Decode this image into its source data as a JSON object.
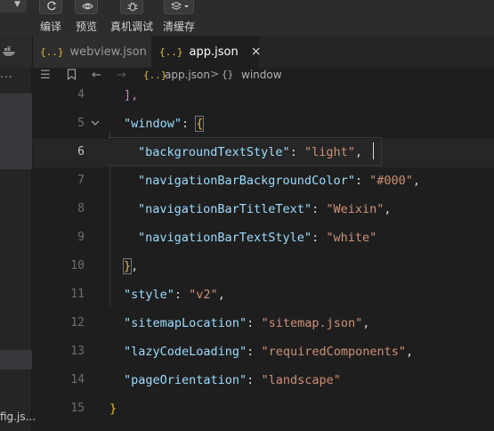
{
  "toolbar": {
    "buttons": [
      {
        "label": "编译",
        "icon": "refresh-icon"
      },
      {
        "label": "预览",
        "icon": "eye-icon"
      },
      {
        "label": "真机调试",
        "icon": "bug-icon"
      },
      {
        "label": "清缓存",
        "icon": "layers-icon"
      }
    ]
  },
  "sidebar": {
    "more": "...",
    "file_fragment": "fig.js..."
  },
  "tabs": [
    {
      "label": "webview.json",
      "active": false
    },
    {
      "label": "app.json",
      "active": true,
      "close": "×"
    }
  ],
  "breadcrumb": {
    "file": "app.json",
    "separator": ">",
    "object_icon": "{}",
    "section": "window"
  },
  "editor": {
    "active_line": 6,
    "lines": [
      {
        "n": "4",
        "parts": [
          "],"
        ]
      },
      {
        "n": "5",
        "parts": [
          "\"window\"",
          ": ",
          "{"
        ]
      },
      {
        "n": "6",
        "parts": [
          "\"backgroundTextStyle\"",
          ": ",
          "\"light\"",
          ","
        ]
      },
      {
        "n": "7",
        "parts": [
          "\"navigationBarBackgroundColor\"",
          ": ",
          "\"#000\"",
          ","
        ]
      },
      {
        "n": "8",
        "parts": [
          "\"navigationBarTitleText\"",
          ": ",
          "\"Weixin\"",
          ","
        ]
      },
      {
        "n": "9",
        "parts": [
          "\"navigationBarTextStyle\"",
          ": ",
          "\"white\""
        ]
      },
      {
        "n": "10",
        "parts": [
          "}",
          ","
        ]
      },
      {
        "n": "11",
        "parts": [
          "\"style\"",
          ": ",
          "\"v2\"",
          ","
        ]
      },
      {
        "n": "12",
        "parts": [
          "\"sitemapLocation\"",
          ": ",
          "\"sitemap.json\"",
          ","
        ]
      },
      {
        "n": "13",
        "parts": [
          "\"lazyCodeLoading\"",
          ": ",
          "\"requiredComponents\"",
          ","
        ]
      },
      {
        "n": "14",
        "parts": [
          "\"pageOrientation\"",
          ": ",
          "\"landscape\""
        ]
      },
      {
        "n": "15",
        "parts": [
          "}"
        ]
      }
    ]
  },
  "colors": {
    "key": "#9cdcfe",
    "string": "#ce9178",
    "bracket_outer": "#e8b93c",
    "bracket_inner": "#c586c0",
    "background": "#1e1e1e"
  }
}
